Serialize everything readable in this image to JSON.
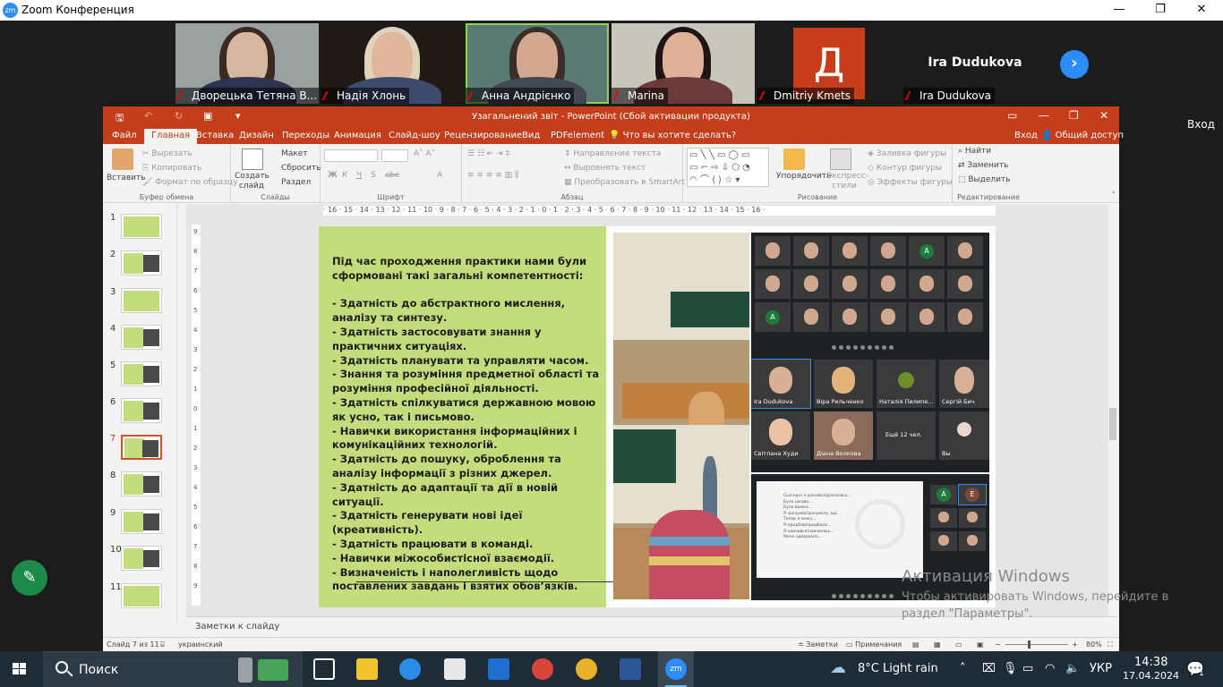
{
  "zoom": {
    "title": "Zoom Конференция",
    "logo": "zm",
    "window_controls": {
      "minimize": "—",
      "restore": "❐",
      "close": "✕"
    },
    "participants": [
      {
        "name": "Дворецька Тетяна В...",
        "muted": true
      },
      {
        "name": "Надія Хлонь",
        "muted": true
      },
      {
        "name": "Анна Андрієнко",
        "muted": true,
        "active": true
      },
      {
        "name": "Marina",
        "muted": true
      },
      {
        "name": "Dmitriy Kmets",
        "muted": true,
        "avatar_letter": "Д",
        "avatar_color": "#c73d1c"
      },
      {
        "name": "Ira Dudukova",
        "muted": true,
        "display_name": "Ira Dudukova"
      }
    ],
    "next_page_icon": "chevron-right-icon",
    "login_label": "Вход",
    "annotate_icon": "pencil-icon"
  },
  "powerpoint": {
    "title": "Узагальнений звіт - PowerPoint (Сбой активации продукта)",
    "tabs": [
      "Файл",
      "Главная",
      "Вставка",
      "Дизайн",
      "Переходы",
      "Анимация",
      "Слайд-шоу",
      "Рецензирование",
      "Вид",
      "PDFelement"
    ],
    "selected_tab": "Главная",
    "tell_me": "Что вы хотите сделать?",
    "signin": "Вход",
    "share": "Общий доступ",
    "ribbon": {
      "clipboard": {
        "paste": "Вставить",
        "cut": "Вырезать",
        "copy": "Копировать",
        "format_painter": "Формат по образцу",
        "group": "Буфер обмена"
      },
      "slides": {
        "new_slide": "Создать слайд",
        "layout": "Макет",
        "reset": "Сбросить",
        "section": "Раздел",
        "group": "Слайды"
      },
      "font": {
        "group": "Шрифт",
        "bold": "Ж",
        "italic": "К",
        "underline": "Ч",
        "shadow": "S",
        "strike": "abc"
      },
      "paragraph": {
        "text_direction": "Направление текста",
        "align_text": "Выровнять текст",
        "smartart": "Преобразовать в SmartArt",
        "group": "Абзац"
      },
      "drawing": {
        "arrange": "Упорядочить",
        "quick_styles": "Экспресс-стили",
        "shape_fill": "Заливка фигуры",
        "shape_outline": "Контур фигуры",
        "shape_effects": "Эффекты фигуры",
        "group": "Рисование"
      },
      "editing": {
        "find": "Найти",
        "replace": "Заменить",
        "select": "Выделить",
        "group": "Редактирование"
      }
    },
    "slide_numbers": [
      "1",
      "2",
      "3",
      "4",
      "5",
      "6",
      "7",
      "8",
      "9",
      "10",
      "11"
    ],
    "selected_slide": "7",
    "ruler_text": "· 16 · 15 · 14 · 13 · 12 · 11 · 10 · 9 · 8 · 7 · 6 · 5 · 4 · 3 · 2 · 1 · 0 · 1 · 2 · 3 · 4 · 5 · 6 · 7 · 8 · 9 · 10 · 11 · 12 · 13 · 14 · 15 · 16 ·",
    "vruler_text": [
      "9",
      "8",
      "7",
      "6",
      "5",
      "4",
      "3",
      "2",
      "1",
      "0",
      "1",
      "2",
      "3",
      "4",
      "5",
      "6",
      "7",
      "8",
      "9"
    ],
    "slide_text": [
      "Під час проходження практики нами були сформовані такі загальні компетентності:",
      "",
      "- Здатність до абстрактного мислення, аналізу та синтезу.",
      "- Здатність застосовувати знання у практичних ситуаціях.",
      "- Здатність планувати та управляти часом.",
      "- Знання та розуміння предметної області та розуміння професійної діяльності.",
      "- Здатність спілкуватися державною мовою як усно, так і письмово.",
      "- Навички використання інформаційних і комунікаційних технологій.",
      "- Здатність до пошуку, оброблення та аналізу інформації з різних джерел.",
      "- Здатність до адаптації та дії в новій ситуації.",
      "- Здатність генерувати нові ідеї (креативність).",
      "- Здатність працювати в команді.",
      "- Навички міжособистісної взаємодії.",
      "- Визначеність і наполегливість щодо поставлених завдань і взятих обов’язків."
    ],
    "zoom_in_slide": {
      "names": [
        "Ira Dudukova",
        "Віра Рильченко",
        "Наталія Пилипе...",
        "Сергій Бич",
        "Світлана Худи",
        "Діана Волкова",
        "Ещё 12 чел.",
        "Вы"
      ],
      "share_lines": [
        "Сьогодні я дізнався/дізналась...",
        "Було цікаво...",
        "Було важко...",
        "Я зрозумів/зрозуміла, що...",
        "Тепер я можу...",
        "Я придбав/придбала...",
        "Я навчився/навчилась...",
        "Мене здивувало..."
      ]
    },
    "notes_placeholder": "Заметки к слайду",
    "status": {
      "slide": "Слайд 7 из 11",
      "language": "украинский",
      "notes": "Заметки",
      "comments": "Примечания",
      "zoom": "80%"
    }
  },
  "windows": {
    "activation_title": "Активация Windows",
    "activation_text": "Чтобы активировать Windows, перейдите в раздел \"Параметры\".",
    "search": "Поиск",
    "weather": "8°C  Light rain",
    "language": "УКР",
    "time": "14:38",
    "date": "17.04.2024",
    "notification_count": "1"
  },
  "colors": {
    "ppt_accent": "#c43e1c",
    "slide_green": "#c3dd7c",
    "zoom_blue": "#2d8cff",
    "taskbar": "#1f2b36"
  }
}
